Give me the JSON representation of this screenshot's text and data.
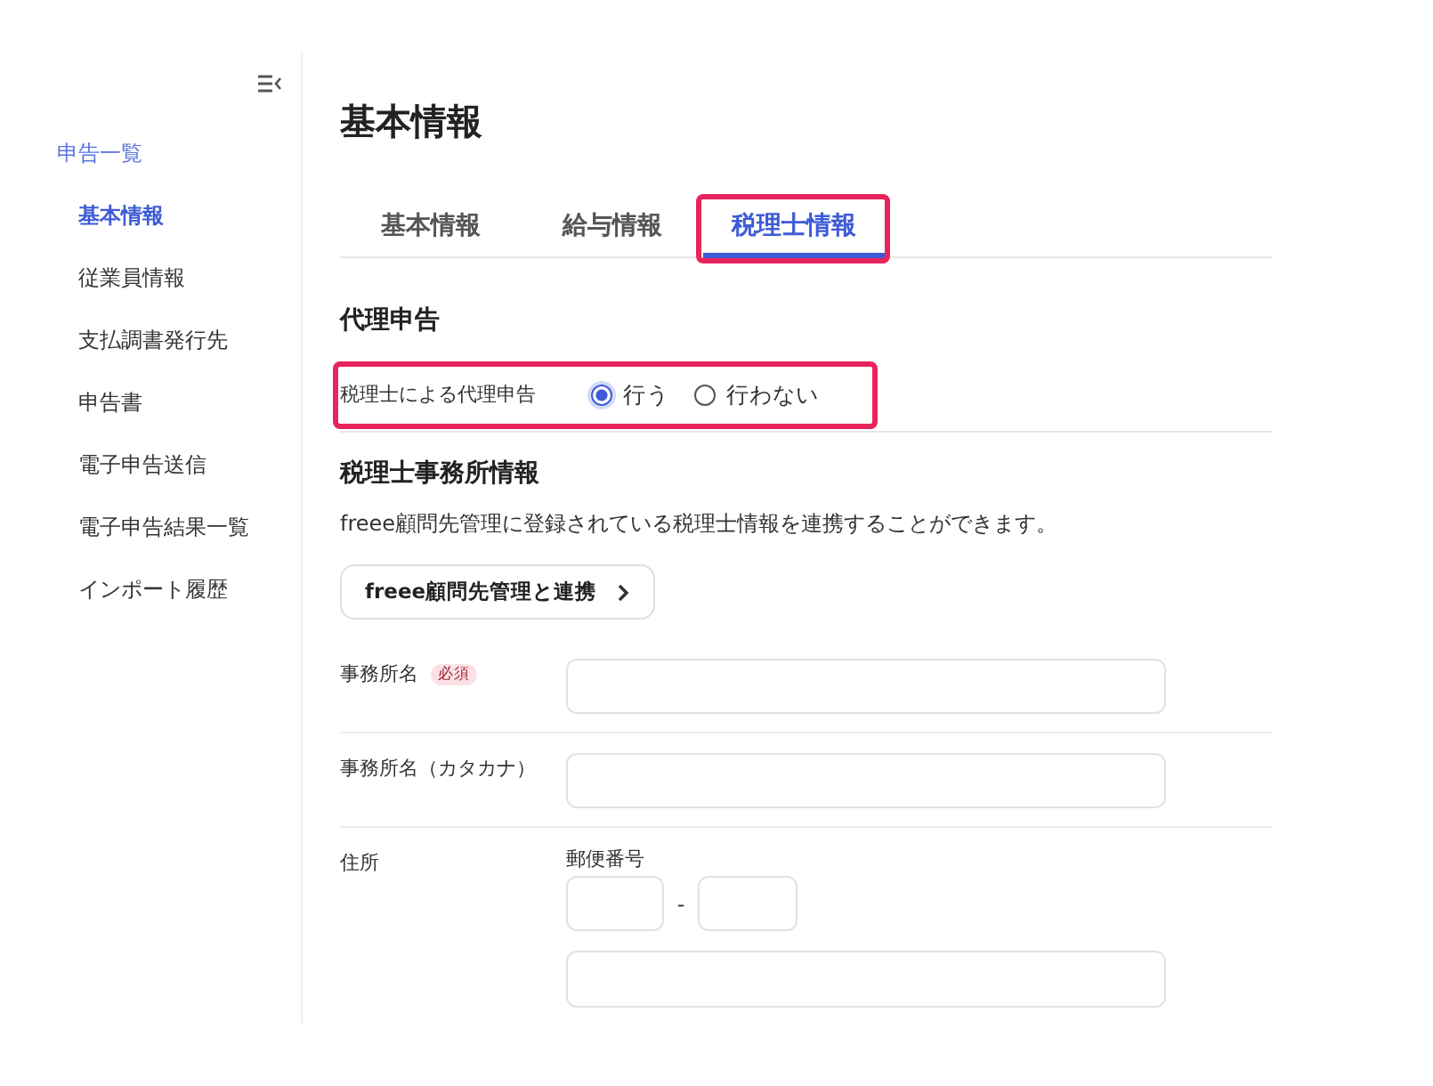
{
  "sidebar": {
    "section_link": "申告一覧",
    "items": [
      {
        "label": "基本情報",
        "selected": true
      },
      {
        "label": "従業員情報",
        "selected": false
      },
      {
        "label": "支払調書発行先",
        "selected": false
      },
      {
        "label": "申告書",
        "selected": false
      },
      {
        "label": "電子申告送信",
        "selected": false
      },
      {
        "label": "電子申告結果一覧",
        "selected": false
      },
      {
        "label": "インポート履歴",
        "selected": false
      }
    ]
  },
  "page": {
    "title": "基本情報"
  },
  "tabs": [
    {
      "label": "基本情報",
      "selected": false,
      "highlighted": false
    },
    {
      "label": "給与情報",
      "selected": false,
      "highlighted": false
    },
    {
      "label": "税理士情報",
      "selected": true,
      "highlighted": true
    }
  ],
  "proxy_filing": {
    "heading": "代理申告",
    "label": "税理士による代理申告",
    "highlighted": true,
    "options": [
      {
        "label": "行う",
        "selected": true
      },
      {
        "label": "行わない",
        "selected": false
      }
    ]
  },
  "office_info": {
    "heading": "税理士事務所情報",
    "description": "freee顧問先管理に登録されている税理士情報を連携することができます。",
    "link_button": "freee顧問先管理と連携",
    "fields": [
      {
        "kind": "text",
        "label": "事務所名",
        "required_badge": "必須"
      },
      {
        "kind": "text",
        "label": "事務所名（カタカナ）"
      },
      {
        "kind": "address",
        "label": "住所",
        "postal_label": "郵便番号",
        "postal_separator": "-"
      }
    ]
  }
}
